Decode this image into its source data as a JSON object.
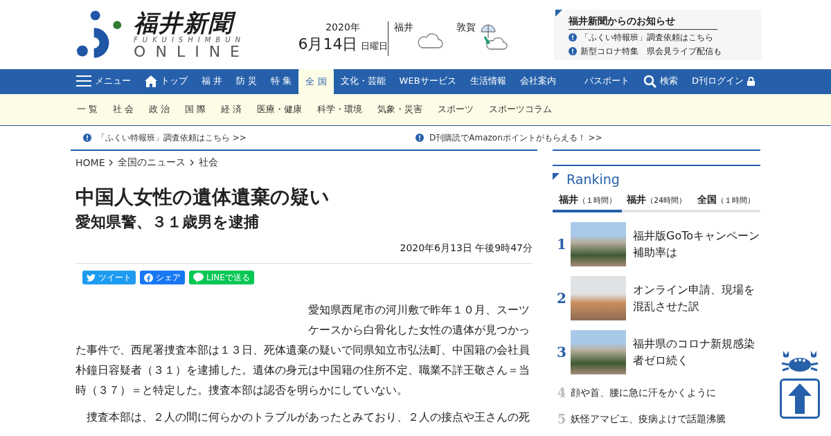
{
  "logo": {
    "title": "福井新聞",
    "romaji": "FUKUISHIMBUN",
    "online": "ONLINE"
  },
  "date": {
    "year": "2020年",
    "day": "6月14日",
    "weekday": "日曜日"
  },
  "weather": [
    {
      "city": "福井",
      "kind": "cloudy"
    },
    {
      "city": "敦賀",
      "kind": "rain-to-cloudy"
    }
  ],
  "notices": {
    "title": "福井新聞からのお知らせ",
    "items": [
      "「ふくい特報班」調査依頼はこちら",
      "新型コロナ特集　県会見ライブ配信も"
    ]
  },
  "nav": {
    "menu": "メニュー",
    "top": "トップ",
    "items": [
      {
        "label": "福 井",
        "selected": false
      },
      {
        "label": "防 災",
        "selected": false
      },
      {
        "label": "特 集",
        "selected": false
      },
      {
        "label": "全 国",
        "selected": true
      },
      {
        "label": "文化・芸能",
        "selected": false
      },
      {
        "label": "WEBサービス",
        "selected": false
      },
      {
        "label": "生活情報",
        "selected": false
      },
      {
        "label": "会社案内",
        "selected": false
      }
    ],
    "passport": "パスポート",
    "search": "検索",
    "login": "D刊ログイン"
  },
  "subnav": [
    "一 覧",
    "社 会",
    "政 治",
    "国 際",
    "経 済",
    "医療・健康",
    "科学・環境",
    "気象・災害",
    "スポーツ",
    "スポーツコラム"
  ],
  "alerts": [
    "「ふくい特報班」調査依頼はこちら >>",
    "D刊購読でAmazonポイントがもらえる！ >>"
  ],
  "breadcrumb": [
    "HOME",
    "全国のニュース",
    "社会"
  ],
  "article": {
    "title": "中国人女性の遺体遺棄の疑い",
    "subtitle": "愛知県警、３１歳男を逮捕",
    "datetime": "2020年6月13日 午後9時47分",
    "share": [
      {
        "kind": "twitter",
        "label": "ツイート"
      },
      {
        "kind": "facebook",
        "label": "シェア"
      },
      {
        "kind": "line",
        "label": "LINEで送る"
      }
    ],
    "paragraphs": [
      "愛知県西尾市の河川敷で昨年１０月、スーツケースから白骨化した女性の遺体が見つかった事件で、西尾署捜査本部は１３日、死体遺棄の疑いで同県知立市弘法町、中国籍の会社員朴鐘日容疑者（３１）を逮捕した。遺体の身元は中国籍の住所不定、職業不詳王敬さん＝当時（３７）＝と特定した。捜査本部は認否を明らかにしていない。",
      "捜査本部は、２人の間に何らかのトラブルがあったとみており、２人の接点や王さんの死"
    ]
  },
  "ranking": {
    "title": "Ranking",
    "tabs": [
      {
        "label": "福井",
        "period": "（１時間）",
        "selected": true
      },
      {
        "label": "福井",
        "period": "（24時間）",
        "selected": false
      },
      {
        "label": "全国",
        "period": "（１時間）",
        "selected": false
      }
    ],
    "items": [
      {
        "rank": "1",
        "kind": "thumb",
        "title": "福井版GoToキャンペーン補助率は"
      },
      {
        "rank": "2",
        "kind": "thumb",
        "title": "オンライン申請、現場を混乱させた訳"
      },
      {
        "rank": "3",
        "kind": "thumb",
        "title": "福井県のコロナ新規感染者ゼロ続く"
      },
      {
        "rank": "4",
        "kind": "plain",
        "title": "顔や首、腰に急に汗をかくように"
      },
      {
        "rank": "5",
        "kind": "plain",
        "title": "妖怪アマビエ、疫病よけで話題沸騰"
      }
    ]
  }
}
